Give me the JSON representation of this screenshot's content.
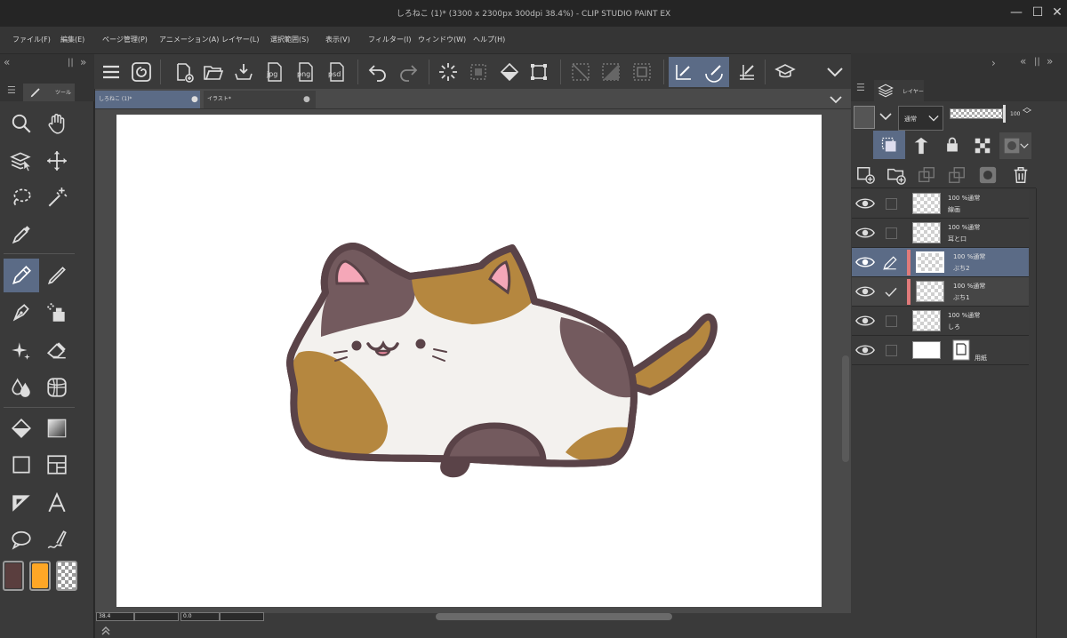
{
  "app": {
    "window_title": "しろねこ (1)* (3300 x 2300px 300dpi 38.4%)  - CLIP STUDIO PAINT EX"
  },
  "menu": [
    {
      "label": "ファイル(F)"
    },
    {
      "label": "編集(E)"
    },
    {
      "label": "ページ管理(P)"
    },
    {
      "label": "アニメーション(A)"
    },
    {
      "label": "レイヤー(L)"
    },
    {
      "label": "選択範囲(S)"
    },
    {
      "label": "表示(V)"
    },
    {
      "label": "フィルター(I)"
    },
    {
      "label": "ウィンドウ(W)"
    },
    {
      "label": "ヘルプ(H)"
    }
  ],
  "command_bar": {
    "export_labels": {
      "jpg": "jpg",
      "png": "png",
      "psd": "psd"
    }
  },
  "tool_panel": {
    "tab_label": "ツール",
    "main_color": "#5a3e3e",
    "sub_color": "#ffa726"
  },
  "document_tabs": [
    {
      "label": "しろねこ (1)*",
      "active": true
    },
    {
      "label": "イラスト*",
      "active": false
    }
  ],
  "layer_panel": {
    "tab_label": "レイヤー",
    "blend_mode": "通常",
    "opacity": "100",
    "layers": [
      {
        "blend": "100 %通常",
        "name": "線画",
        "selected": false,
        "checked": false
      },
      {
        "blend": "100 %通常",
        "name": "耳と口",
        "selected": false,
        "checked": false
      },
      {
        "blend": "100 %通常",
        "name": "ぶち2",
        "selected": true,
        "checked": false
      },
      {
        "blend": "100 %通常",
        "name": "ぶち1",
        "selected": false,
        "checked": true
      },
      {
        "blend": "100 %通常",
        "name": "しろ",
        "selected": false,
        "checked": false
      },
      {
        "blend": "",
        "name": "用紙",
        "selected": false,
        "checked": false
      }
    ]
  },
  "status_bar": {
    "zoom": "38.4",
    "angle": "0.0"
  },
  "colors": {
    "accent": "#5b6b86",
    "cat_outline": "#5a4348",
    "cat_brown": "#b5873f",
    "cat_gray": "#735a5e",
    "cat_white": "#f3f1ee",
    "ear_pink": "#f5a7b8"
  }
}
